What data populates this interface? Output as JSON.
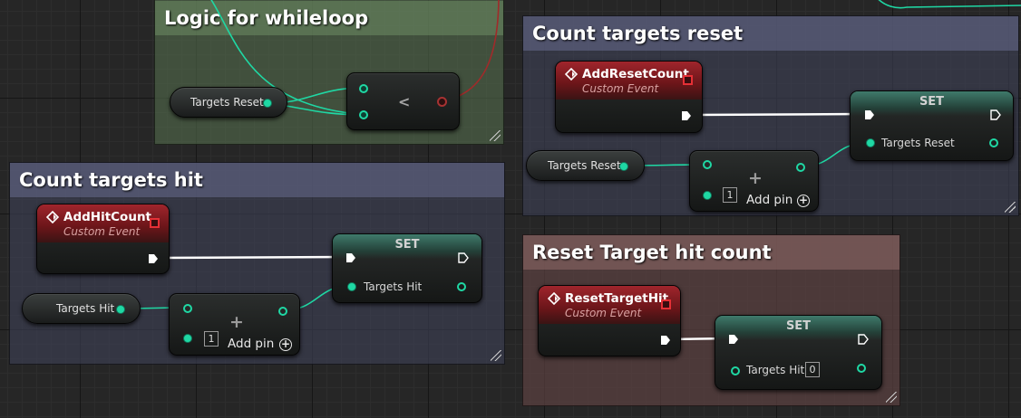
{
  "comments": {
    "logic": {
      "title": "Logic for whileloop",
      "color": "#536b4c"
    },
    "reset": {
      "title": "Count targets reset",
      "color": "#3d4056"
    },
    "hit": {
      "title": "Count targets hit",
      "color": "#3d4056"
    },
    "reset_hit": {
      "title": "Reset Target hit count",
      "color": "#5e4342"
    }
  },
  "nodes": {
    "logic_var": {
      "label": "Targets Reset"
    },
    "logic_compare": {
      "operator": "<"
    },
    "reset_event": {
      "title": "AddResetCount",
      "subtitle": "Custom Event"
    },
    "reset_set": {
      "title": "SET",
      "pin_label": "Targets Reset"
    },
    "reset_var": {
      "label": "Targets Reset"
    },
    "reset_add": {
      "operator": "+",
      "literal": "1",
      "add_pin_label": "Add pin"
    },
    "hit_event": {
      "title": "AddHitCount",
      "subtitle": "Custom Event"
    },
    "hit_set": {
      "title": "SET",
      "pin_label": "Targets Hit"
    },
    "hit_var": {
      "label": "Targets Hit"
    },
    "hit_add": {
      "operator": "+",
      "literal": "1",
      "add_pin_label": "Add pin"
    },
    "resethit_event": {
      "title": "ResetTargetHit",
      "subtitle": "Custom Event"
    },
    "resethit_set": {
      "title": "SET",
      "pin_label": "Targets Hit",
      "literal": "0"
    }
  },
  "colors": {
    "integer_pin": "#1fd8a4",
    "boolean_wire": "#a02a2a",
    "exec_wire": "#ffffff",
    "event_header": "#a0252c",
    "set_header": "#3f7a6b"
  },
  "icons": {
    "event": "event-diamond-icon",
    "exec": "exec-arrow-icon",
    "delegate": "delegate-square-icon",
    "add_pin": "plus-circle-icon"
  }
}
